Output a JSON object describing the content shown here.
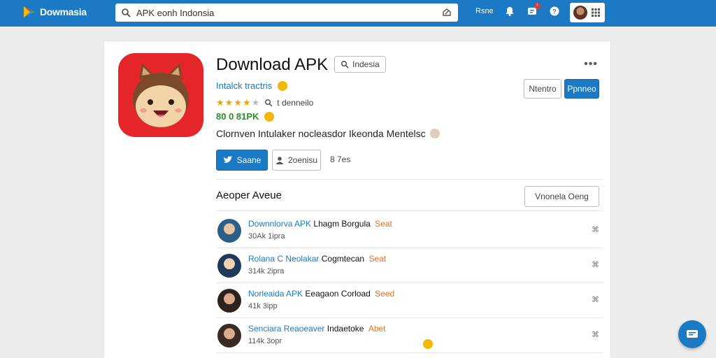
{
  "brand": {
    "name": "Dowmasia",
    "accent": "#1c7ac4"
  },
  "search": {
    "value": "APK eonh Indonsia",
    "placeholder": ""
  },
  "topbar": {
    "link": "Rsne"
  },
  "app": {
    "title": "Download APK",
    "region": "Indesia",
    "developer": "Intalck tractris",
    "rating_text": "t denneilo",
    "stars": 4,
    "downloads": "80 0 81PK",
    "description": "Clornven Intulaker nocleasdor Ikeonda Mentelsc"
  },
  "actions": {
    "share": "Saane",
    "reviews": "2oenisu",
    "stat": "8 7es",
    "button1": "Ntentro",
    "button2": "Ppnneo"
  },
  "section": {
    "title": "Aeoper Aveue",
    "button": "Vnonela Oeng"
  },
  "list": [
    {
      "link": "Downnlorva APK",
      "text": "Lhagm Borgula",
      "tag": "Seat",
      "meta": "30Ak 1ipra",
      "action": "⌘"
    },
    {
      "link": "Rolana C Neolakar",
      "text": "Cogmtecan",
      "tag": "Seat",
      "meta": "314k 2ipra",
      "action": "⌘"
    },
    {
      "link": "Norleaida APK",
      "text": "Eeagaon Corload",
      "tag": "Seed",
      "meta": "41k 3ipp",
      "action": "⌘"
    },
    {
      "link": "Senciara Reaoeaver",
      "text": "Indaetoke",
      "tag": "Abet",
      "meta": "114k 3opr",
      "action": "⌘"
    }
  ],
  "icons": {
    "search": "search-icon",
    "bell": "bell-icon",
    "notify": "notification-icon",
    "help": "help-icon",
    "apps": "apps-grid-icon"
  }
}
